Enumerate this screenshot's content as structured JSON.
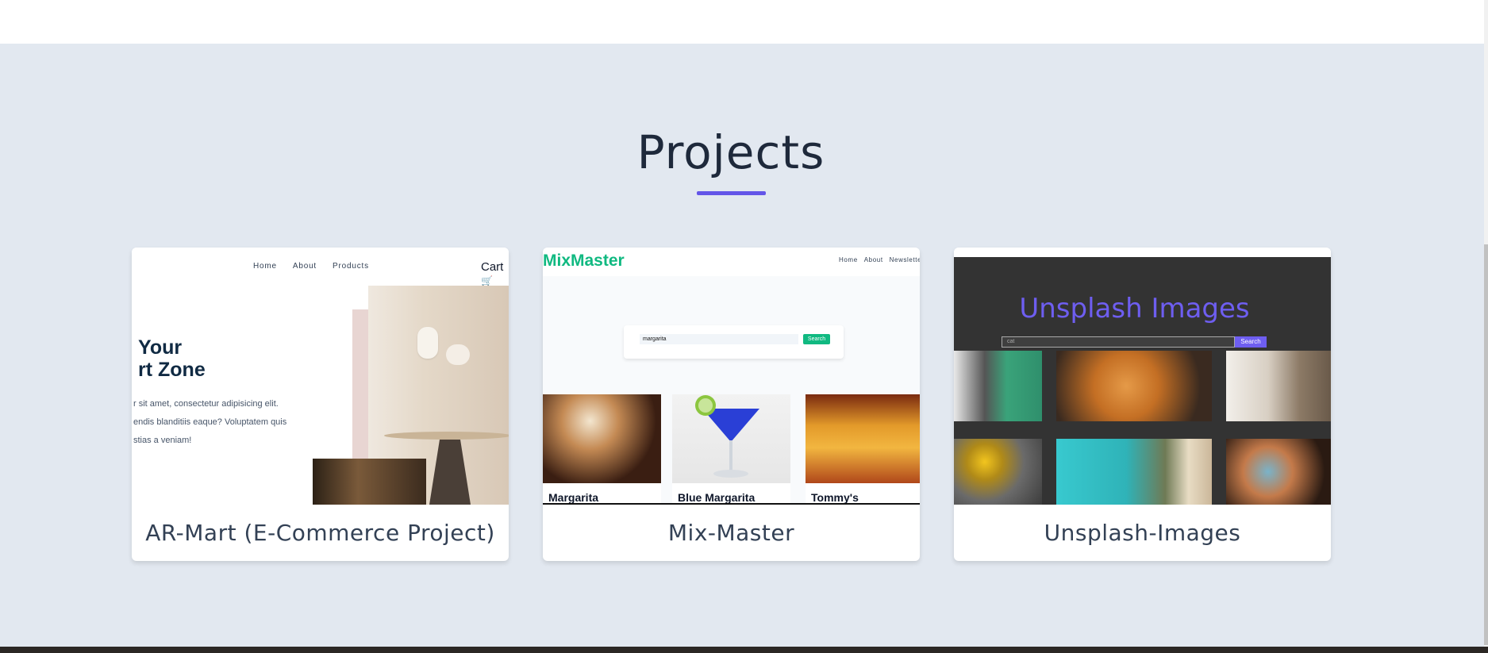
{
  "section": {
    "title": "Projects",
    "accent_color": "#6355e8"
  },
  "projects": [
    {
      "caption": "AR-Mart (E-Commerce Project)",
      "preview": {
        "nav": [
          "Home",
          "About",
          "Products"
        ],
        "cart": "Cart",
        "headline_1": "Your",
        "headline_2": "rt Zone",
        "paragraph_1": "r sit amet, consectetur adipisicing elit.",
        "paragraph_2": "endis blanditiis eaque? Voluptatem quis",
        "paragraph_3": "stias a veniam!"
      }
    },
    {
      "caption": "Mix-Master",
      "preview": {
        "logo": "MixMaster",
        "nav": [
          "Home",
          "About",
          "Newslette"
        ],
        "search_value": "margarita",
        "search_button": "Search",
        "drinks": [
          "Margarita",
          "Blue Margarita",
          "Tommy's"
        ]
      }
    },
    {
      "caption": "Unsplash-Images",
      "preview": {
        "title": "Unsplash Images",
        "search_value": "cat",
        "search_button": "Search"
      }
    }
  ]
}
